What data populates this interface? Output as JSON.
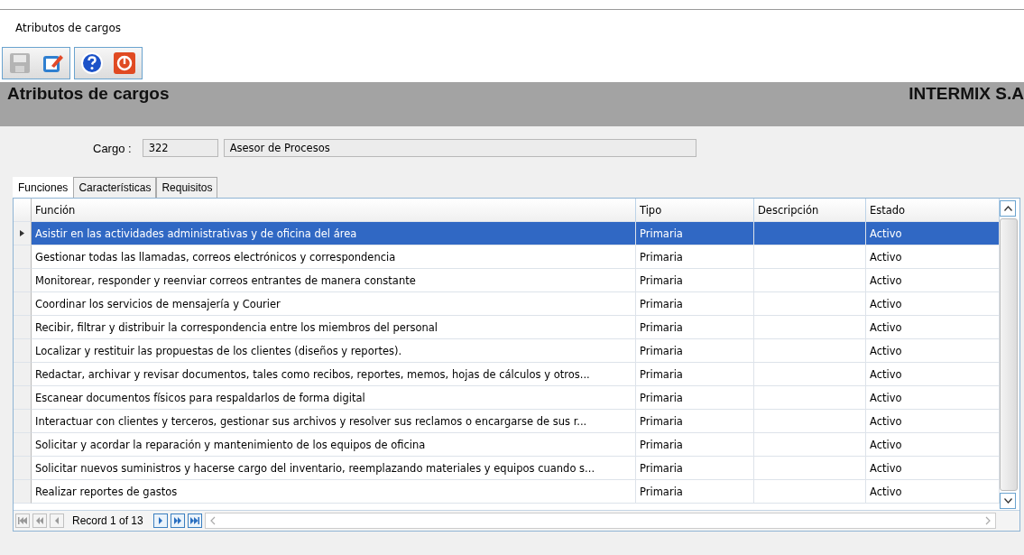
{
  "window": {
    "title": "Atributos de cargos"
  },
  "toolbar": {
    "groups": [
      {
        "buttons": [
          {
            "kind": "save",
            "disabled": true
          },
          {
            "kind": "edit",
            "disabled": false
          }
        ]
      },
      {
        "buttons": [
          {
            "kind": "help",
            "disabled": false
          },
          {
            "kind": "power",
            "disabled": false
          }
        ]
      }
    ]
  },
  "header": {
    "title": "Atributos de cargos",
    "company": "INTERMIX S.A"
  },
  "cargo": {
    "label": "Cargo :",
    "code": "322",
    "name": "Asesor de Procesos"
  },
  "tabs": [
    {
      "label": "Funciones",
      "selected": true
    },
    {
      "label": "Características",
      "selected": false
    },
    {
      "label": "Requisitos",
      "selected": false
    }
  ],
  "table": {
    "columns": [
      "Función",
      "Tipo",
      "Descripción",
      "Estado"
    ],
    "rows": [
      {
        "funcion": "Asistir en las actividades administrativas y de oficina del área",
        "tipo": "Primaria",
        "estado": "Activo",
        "selected": true
      },
      {
        "funcion": "Gestionar todas las llamadas, correos electrónicos y correspondencia",
        "tipo": "Primaria",
        "estado": "Activo",
        "selected": false
      },
      {
        "funcion": "Monitorear, responder y reenviar correos entrantes de manera constante",
        "tipo": "Primaria",
        "estado": "Activo",
        "selected": false
      },
      {
        "funcion": "Coordinar los servicios de mensajería y Courier",
        "tipo": "Primaria",
        "estado": "Activo",
        "selected": false
      },
      {
        "funcion": " Recibir, filtrar y distribuir la correspondencia entre los miembros del personal",
        "tipo": "Primaria",
        "estado": "Activo",
        "selected": false
      },
      {
        "funcion": "Localizar y restituir las propuestas de los clientes (diseños y reportes).",
        "tipo": "Primaria",
        "estado": "Activo",
        "selected": false
      },
      {
        "funcion": "Redactar, archivar y revisar documentos, tales como recibos, reportes, memos, hojas de cálculos y otros...",
        "tipo": "Primaria",
        "estado": "Activo",
        "selected": false
      },
      {
        "funcion": "Escanear documentos físicos para respaldarlos de forma digital",
        "tipo": "Primaria",
        "estado": "Activo",
        "selected": false
      },
      {
        "funcion": "Interactuar con clientes y terceros, gestionar sus archivos y resolver sus reclamos o encargarse de sus r...",
        "tipo": "Primaria",
        "estado": "Activo",
        "selected": false
      },
      {
        "funcion": "Solicitar y acordar la reparación y mantenimiento de los equipos de oficina",
        "tipo": "Primaria",
        "estado": "Activo",
        "selected": false
      },
      {
        "funcion": "Solicitar nuevos suministros y hacerse cargo del inventario, reemplazando materiales y equipos cuando s...",
        "tipo": "Primaria",
        "estado": "Activo",
        "selected": false
      },
      {
        "funcion": "Realizar reportes de gastos",
        "tipo": "Primaria",
        "estado": "Activo",
        "selected": false
      }
    ]
  },
  "navigator": {
    "record": "Record 1 of 13"
  }
}
